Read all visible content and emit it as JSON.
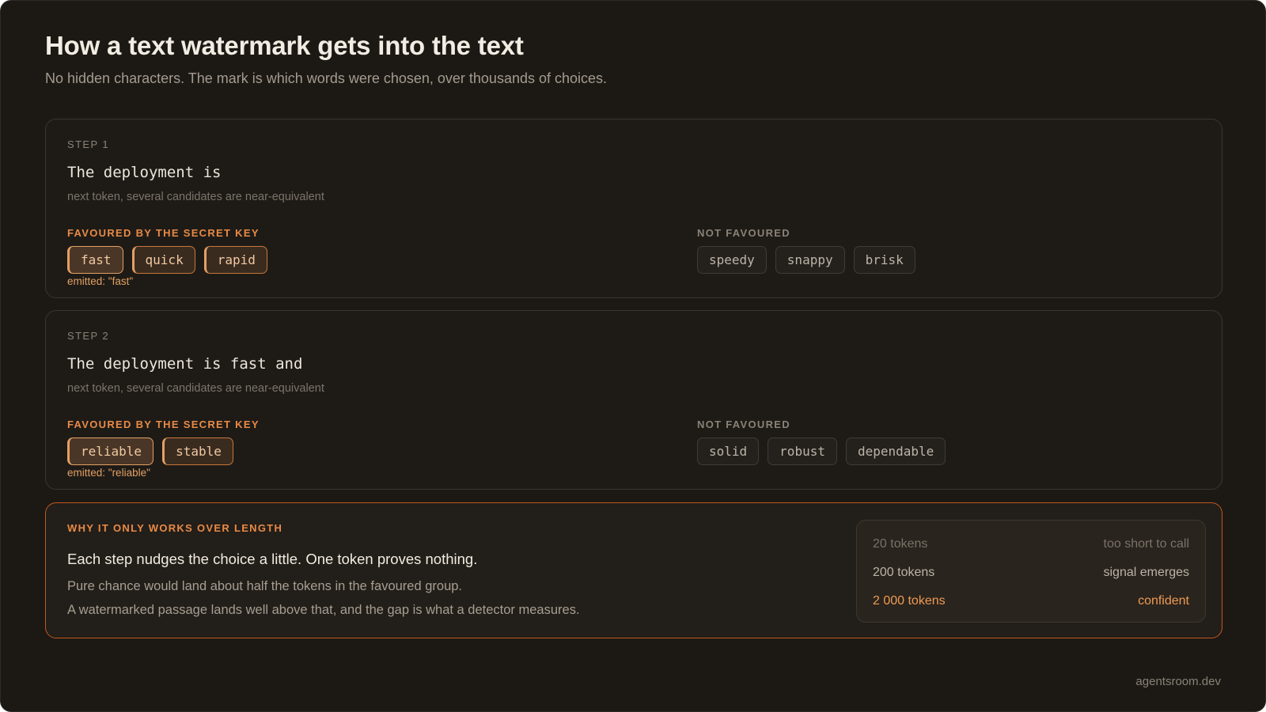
{
  "header": {
    "title": "How a text watermark gets into the text",
    "subtitle": "No hidden characters. The mark is which words were chosen, over thousands of choices."
  },
  "steps": [
    {
      "label": "STEP 1",
      "sentence": "The deployment is",
      "hint": "next token, several candidates are near-equivalent",
      "favoured_heading": "FAVOURED BY THE SECRET KEY",
      "favoured": [
        "fast",
        "quick",
        "rapid"
      ],
      "emitted_note": "emitted: \"fast\"",
      "not_favoured_heading": "NOT FAVOURED",
      "not_favoured": [
        "speedy",
        "snappy",
        "brisk"
      ]
    },
    {
      "label": "STEP 2",
      "sentence": "The deployment is fast and",
      "hint": "next token, several candidates are near-equivalent",
      "favoured_heading": "FAVOURED BY THE SECRET KEY",
      "favoured": [
        "reliable",
        "stable"
      ],
      "emitted_note": "emitted: \"reliable\"",
      "not_favoured_heading": "NOT FAVOURED",
      "not_favoured": [
        "solid",
        "robust",
        "dependable"
      ]
    }
  ],
  "length_panel": {
    "heading": "WHY IT ONLY WORKS OVER LENGTH",
    "lead": "Each step nudges the choice a little. One token proves nothing.",
    "line1": "Pure chance would land about half the tokens in the favoured group.",
    "line2": "A watermarked passage lands well above that, and the gap is what a detector measures.",
    "rows": [
      {
        "tokens": "20 tokens",
        "verdict": "too short to call"
      },
      {
        "tokens": "200 tokens",
        "verdict": "signal emerges"
      },
      {
        "tokens": "2 000 tokens",
        "verdict": "confident"
      }
    ]
  },
  "footer": {
    "brand": "agentsroom.dev"
  },
  "colors": {
    "accent": "#e98a46",
    "background": "#1c1915",
    "panel_border": "#c2571d"
  }
}
